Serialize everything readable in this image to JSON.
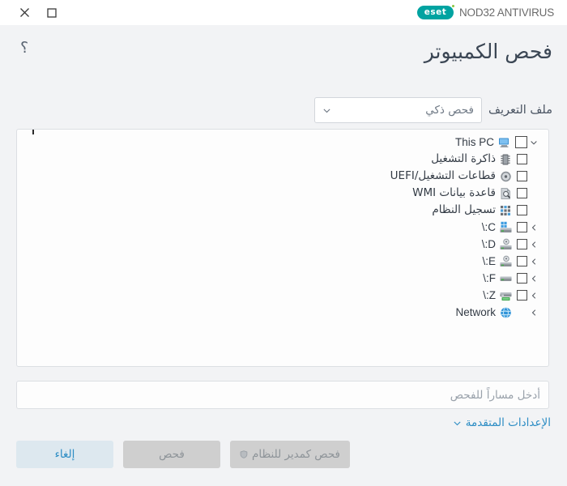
{
  "titlebar": {
    "close_label": "×",
    "maximize_label": "□",
    "brand_mark": "eset",
    "brand_name": "NOD32 ANTIVIRUS"
  },
  "header": {
    "title": "فحص الكمبيوتر",
    "help_label": "؟"
  },
  "profile": {
    "label": "ملف التعريف",
    "selected": "فحص ذكي"
  },
  "tree": {
    "items": [
      {
        "label": "This PC",
        "lang": "en",
        "icon": "computer-icon",
        "checkbox": true,
        "chevron": "down",
        "level": 1
      },
      {
        "label": "ذاكرة التشغيل",
        "lang": "ar",
        "icon": "memory-icon",
        "checkbox": true,
        "chevron": "none",
        "level": 2
      },
      {
        "label": "قطاعات التشغيل/UEFI",
        "lang": "ar",
        "icon": "disc-icon",
        "checkbox": true,
        "chevron": "none",
        "level": 2
      },
      {
        "label": "قاعدة بيانات WMI",
        "lang": "ar",
        "icon": "wmi-icon",
        "checkbox": true,
        "chevron": "none",
        "level": 2
      },
      {
        "label": "تسجيل النظام",
        "lang": "ar",
        "icon": "registry-icon",
        "checkbox": true,
        "chevron": "none",
        "level": 2
      },
      {
        "label": "C:\\",
        "lang": "en",
        "icon": "windows-drive-icon",
        "checkbox": true,
        "chevron": "left",
        "level": 2
      },
      {
        "label": "D:\\",
        "lang": "en",
        "icon": "optical-drive-icon",
        "checkbox": true,
        "chevron": "left",
        "level": 2
      },
      {
        "label": "E:\\",
        "lang": "en",
        "icon": "optical-drive-icon",
        "checkbox": true,
        "chevron": "left",
        "level": 2
      },
      {
        "label": "F:\\",
        "lang": "en",
        "icon": "drive-icon",
        "checkbox": true,
        "chevron": "left",
        "level": 2
      },
      {
        "label": "Z:\\",
        "lang": "en",
        "icon": "network-drive-icon",
        "checkbox": true,
        "chevron": "left",
        "level": 2
      },
      {
        "label": "Network",
        "lang": "en",
        "icon": "globe-icon",
        "checkbox": false,
        "chevron": "left",
        "level": 1
      }
    ]
  },
  "path_field": {
    "placeholder": "أدخل مساراً للفحص",
    "value": ""
  },
  "advanced": {
    "label": "الإعدادات المتقدمة"
  },
  "buttons": {
    "cancel": "إلغاء",
    "scan": "فحص",
    "scan_admin": "فحص كمدير للنظام"
  },
  "colors": {
    "brand_teal": "#00a3a1",
    "accent_blue": "#2b8cc4",
    "cancel_bg": "#dde8ef",
    "disabled_bg": "#cfcfcf",
    "body_bg": "#f2f3f5",
    "panel_bg": "#fdfdfd"
  }
}
